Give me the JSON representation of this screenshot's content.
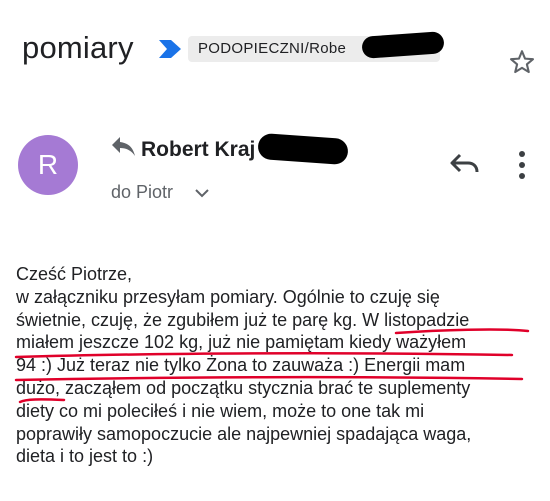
{
  "subject": "pomiary",
  "label": "PODOPIECZNI/Robe",
  "sender": {
    "initial": "R",
    "name": "Robert Kraj"
  },
  "recipient": "do Piotr",
  "body": [
    "Cześć Piotrze,",
    "w załączniku przesyłam pomiary. Ogólnie to czuję się",
    "świetnie, czuję, że zgubiłem już te parę kg. W listopadzie",
    "miałem jeszcze 102 kg, już nie pamiętam kiedy ważyłem",
    "94 :) Już teraz nie tylko Żona to zauważa :) Energii mam",
    "dużo, zacząłem od początku stycznia brać te suplementy",
    "diety co mi poleciłeś i nie wiem, może to one tak mi",
    "poprawiły samopoczucie ale najpewniej spadająca waga,",
    "dieta i to jest to  :)"
  ],
  "colors": {
    "avatar": "#a57ad4",
    "label_arrow": "#1a73e8",
    "underline": "#e0002a"
  },
  "icons": [
    "label-arrow-icon",
    "star-icon",
    "forward-icon",
    "chevron-down-icon",
    "reply-icon",
    "more-vert-icon"
  ]
}
